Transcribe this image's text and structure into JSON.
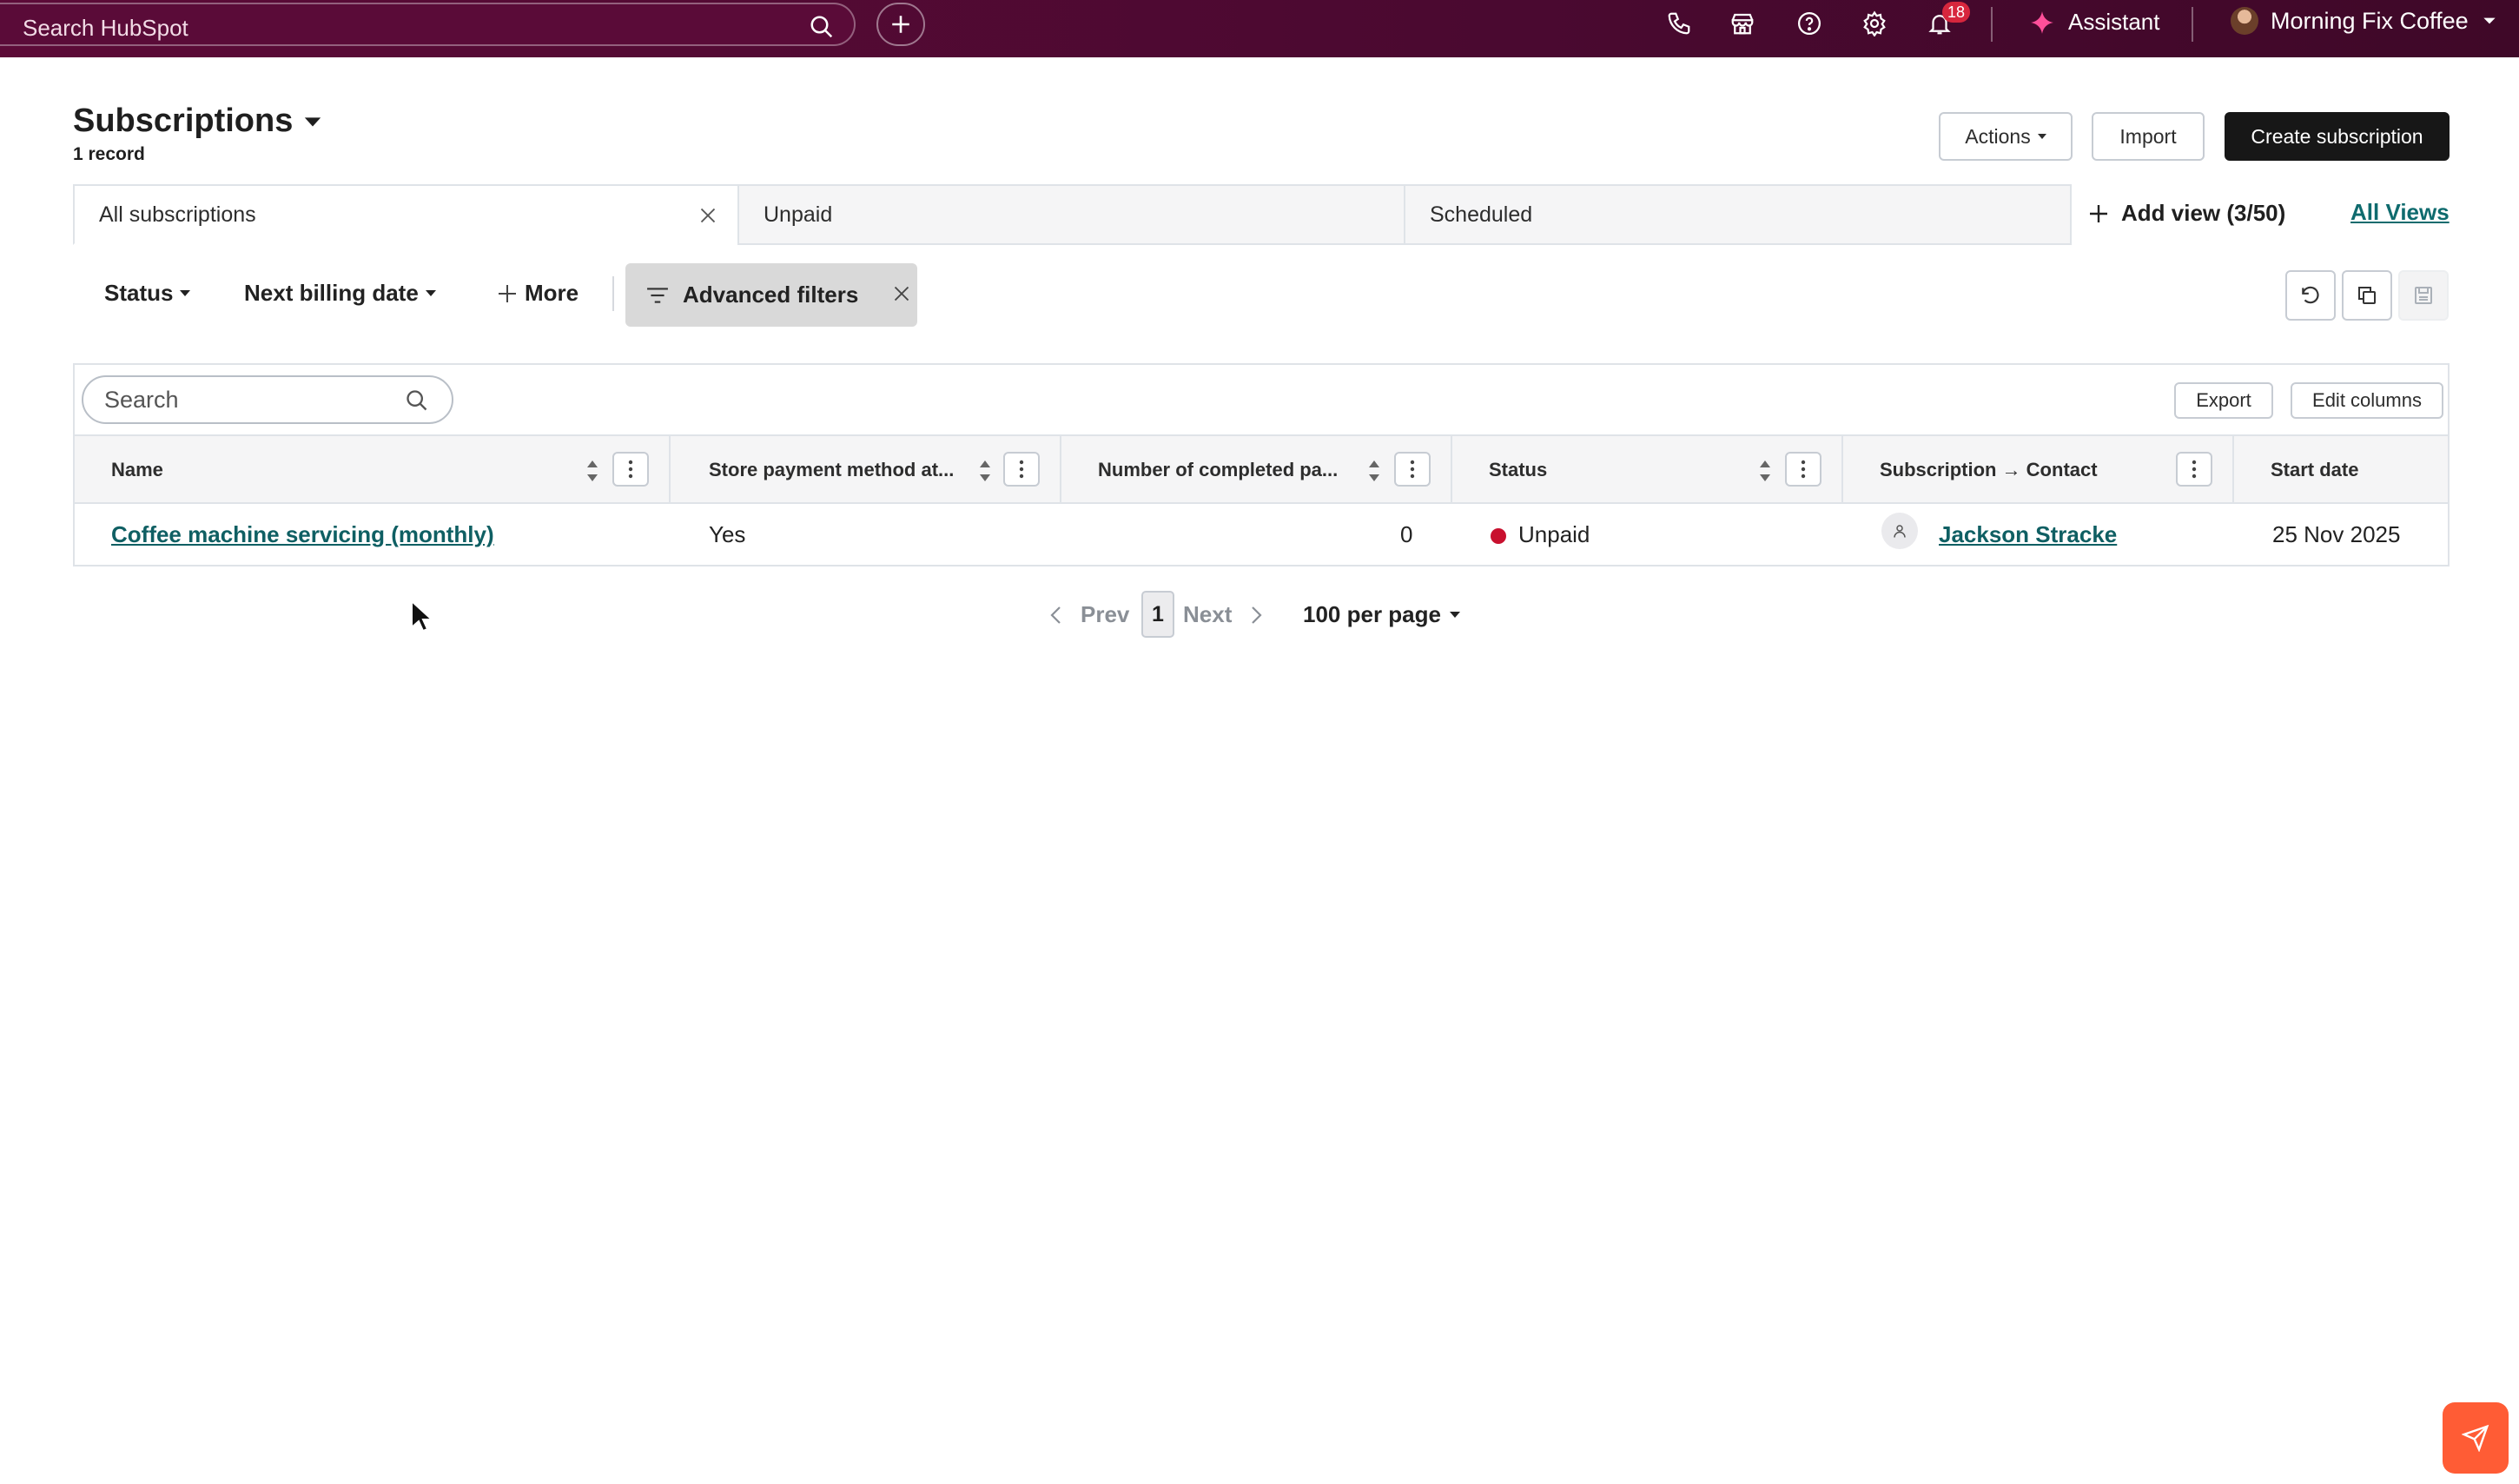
{
  "topbar": {
    "search_placeholder": "Search HubSpot",
    "notifications_count": "18",
    "assistant_label": "Assistant",
    "account_name": "Morning Fix Coffee",
    "brand_color": "#5c0a37"
  },
  "header": {
    "title": "Subscriptions",
    "record_count": "1 record",
    "actions_label": "Actions",
    "import_label": "Import",
    "create_label": "Create subscription"
  },
  "views": {
    "tabs": [
      {
        "label": "All subscriptions",
        "active": true,
        "closable": true
      },
      {
        "label": "Unpaid",
        "active": false
      },
      {
        "label": "Scheduled",
        "active": false
      }
    ],
    "add_view_label": "Add view (3/50)",
    "all_views_label": "All Views"
  },
  "filters": {
    "status_label": "Status",
    "next_billing_label": "Next billing date",
    "more_label": "More",
    "advanced_label": "Advanced filters"
  },
  "table": {
    "search_placeholder": "Search",
    "export_label": "Export",
    "edit_columns_label": "Edit columns",
    "columns": [
      "Name",
      "Store payment method at...",
      "Number of completed pa...",
      "Status",
      "Subscription → Contact",
      "Start date"
    ],
    "rows": [
      {
        "name": "Coffee machine servicing (monthly)",
        "store_payment": "Yes",
        "completed_payments": "0",
        "status": "Unpaid",
        "status_color": "#c8102e",
        "contact": "Jackson Stracke",
        "start_date": "25 Nov 2025"
      }
    ]
  },
  "pagination": {
    "prev_label": "Prev",
    "current_page": "1",
    "next_label": "Next",
    "per_page_label": "100 per page"
  },
  "colors": {
    "link": "#0f5f63",
    "accent_chat": "#ff5c35"
  }
}
